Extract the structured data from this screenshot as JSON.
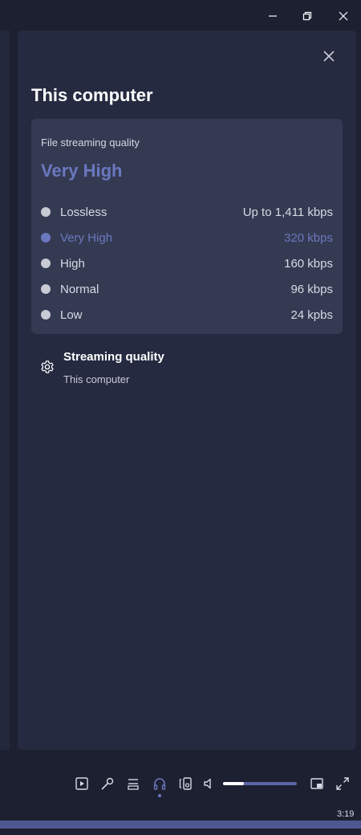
{
  "window": {
    "minimize_icon": "minimize-icon",
    "restore_icon": "restore-icon",
    "close_icon": "close-icon"
  },
  "panel": {
    "title": "This computer",
    "close_icon": "close-icon",
    "card": {
      "label": "File streaming quality",
      "selected_value": "Very High",
      "options": [
        {
          "name": "Lossless",
          "rate": "Up to 1,411 kbps",
          "selected": false
        },
        {
          "name": "Very High",
          "rate": "320 kbps",
          "selected": true
        },
        {
          "name": "High",
          "rate": "160 kbps",
          "selected": false
        },
        {
          "name": "Normal",
          "rate": "96 kbps",
          "selected": false
        },
        {
          "name": "Low",
          "rate": "24 kpbs",
          "selected": false
        }
      ]
    },
    "setting": {
      "icon": "gear-icon",
      "title": "Streaming quality",
      "subtitle": "This computer"
    }
  },
  "player": {
    "controls": [
      {
        "name": "now-playing-view-icon"
      },
      {
        "name": "microphone-icon"
      },
      {
        "name": "queue-icon"
      },
      {
        "name": "headphones-icon"
      },
      {
        "name": "connect-device-icon"
      },
      {
        "name": "volume-icon"
      },
      {
        "name": "mini-player-icon"
      },
      {
        "name": "fullscreen-icon"
      }
    ],
    "volume_level": 0.28,
    "time": "3:19",
    "progress": 1.0
  },
  "colors": {
    "background": "#1c2031",
    "panel": "#252a40",
    "card": "#343a52",
    "accent": "#6b78c0"
  }
}
